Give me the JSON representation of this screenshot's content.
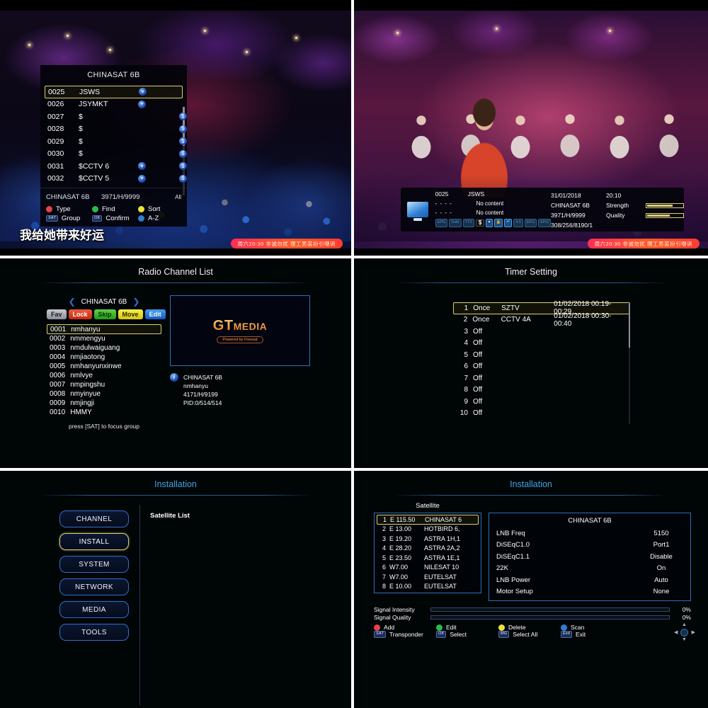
{
  "panel_channel_list": {
    "title": "CHINASAT 6B",
    "rows": [
      {
        "num": "0025",
        "name": "JSWS",
        "fav": true,
        "scrambled": false,
        "selected": true
      },
      {
        "num": "0026",
        "name": "JSYMKT",
        "fav": true,
        "scrambled": false,
        "selected": false
      },
      {
        "num": "0027",
        "name": "$",
        "fav": false,
        "scrambled": true,
        "selected": false
      },
      {
        "num": "0028",
        "name": "$",
        "fav": false,
        "scrambled": true,
        "selected": false
      },
      {
        "num": "0029",
        "name": "$",
        "fav": false,
        "scrambled": true,
        "selected": false
      },
      {
        "num": "0030",
        "name": "$",
        "fav": false,
        "scrambled": true,
        "selected": false
      },
      {
        "num": "0031",
        "name": "$CCTV 6",
        "fav": true,
        "scrambled": true,
        "selected": false
      },
      {
        "num": "0032",
        "name": "$CCTV 5",
        "fav": true,
        "scrambled": true,
        "selected": false
      }
    ],
    "footer": {
      "satellite": "CHINASAT 6B",
      "transponder": "3971/H/9999",
      "filter": "All"
    },
    "keys_row1": [
      {
        "color": "#e8414a",
        "label": "Type"
      },
      {
        "color": "#2fb84a",
        "label": "Find"
      },
      {
        "color": "#ece23a",
        "label": "Sort"
      }
    ],
    "keys_row2": [
      {
        "btn": "SAT",
        "label": "Group"
      },
      {
        "btn": "OK",
        "label": "Confirm"
      },
      {
        "color": "#2f7fd4",
        "label": "A-Z"
      }
    ],
    "subtitle": "我给她带来好运",
    "promo": "周六20:30 非诚勿扰 理工男装扮引嘲讽"
  },
  "panel_info_banner": {
    "channel_number": "0025",
    "channel_name": "JSWS",
    "events": [
      {
        "time": "- - - -",
        "name": "No content"
      },
      {
        "time": "- - - -",
        "name": "No content"
      }
    ],
    "icons": [
      "EPG",
      "Subt",
      "TTX",
      "$",
      "fav-heart",
      "lock",
      "repeat",
      "4:3",
      "EPG",
      "EPG"
    ],
    "date": "31/01/2018",
    "time": "20:10",
    "satellite": "CHINASAT 6B",
    "transponder": "3971/H/9999",
    "pids": "308/256/8190/1",
    "strength_label": "Strength",
    "quality_label": "Quality",
    "strength_pct": 78,
    "quality_pct": 72,
    "promo": "周六20:30 非诚勿扰 理工男装扮引嘲讽"
  },
  "panel_radio": {
    "title": "Radio Channel List",
    "group": "CHINASAT 6B",
    "tags": [
      {
        "label": "Fav",
        "cls": "fav"
      },
      {
        "label": "Lock",
        "cls": "lock"
      },
      {
        "label": "Skip",
        "cls": "skip"
      },
      {
        "label": "Move",
        "cls": "move"
      },
      {
        "label": "Edit",
        "cls": "edit"
      }
    ],
    "rows": [
      {
        "num": "0001",
        "name": "nmhanyu",
        "selected": true
      },
      {
        "num": "0002",
        "name": "nmmengyu",
        "selected": false
      },
      {
        "num": "0003",
        "name": "nmdulwaiguang",
        "selected": false
      },
      {
        "num": "0004",
        "name": "nmjiaotong",
        "selected": false
      },
      {
        "num": "0005",
        "name": "nmhanyunxinwe",
        "selected": false
      },
      {
        "num": "0006",
        "name": "nmlvye",
        "selected": false
      },
      {
        "num": "0007",
        "name": "nmpingshu",
        "selected": false
      },
      {
        "num": "0008",
        "name": "nmyinyue",
        "selected": false
      },
      {
        "num": "0009",
        "name": "nmjingji",
        "selected": false
      },
      {
        "num": "0010",
        "name": "HMMY",
        "selected": false
      }
    ],
    "hint": "press [SAT] to focus group",
    "logo_main": "GT",
    "logo_sub_main": "MEDIA",
    "logo_tagline": "Powered by Freesat",
    "info": [
      "CHINASAT 6B",
      "nmhanyu",
      "4171/H/9199",
      "PID:0/514/514"
    ]
  },
  "panel_timer": {
    "title": "Timer Setting",
    "rows": [
      {
        "index": "1",
        "mode": "Once",
        "channel": "SZTV",
        "schedule": "01/02/2018 00:19-00:29",
        "selected": true
      },
      {
        "index": "2",
        "mode": "Once",
        "channel": "CCTV 4A",
        "schedule": "01/02/2018 00:30-00:40",
        "selected": false
      },
      {
        "index": "3",
        "mode": "Off",
        "channel": "",
        "schedule": "",
        "selected": false
      },
      {
        "index": "4",
        "mode": "Off",
        "channel": "",
        "schedule": "",
        "selected": false
      },
      {
        "index": "5",
        "mode": "Off",
        "channel": "",
        "schedule": "",
        "selected": false
      },
      {
        "index": "6",
        "mode": "Off",
        "channel": "",
        "schedule": "",
        "selected": false
      },
      {
        "index": "7",
        "mode": "Off",
        "channel": "",
        "schedule": "",
        "selected": false
      },
      {
        "index": "8",
        "mode": "Off",
        "channel": "",
        "schedule": "",
        "selected": false
      },
      {
        "index": "9",
        "mode": "Off",
        "channel": "",
        "schedule": "",
        "selected": false
      },
      {
        "index": "10",
        "mode": "Off",
        "channel": "",
        "schedule": "",
        "selected": false
      }
    ]
  },
  "panel_install_menu": {
    "title": "Installation",
    "buttons": [
      {
        "label": "CHANNEL",
        "selected": false
      },
      {
        "label": "INSTALL",
        "selected": true
      },
      {
        "label": "SYSTEM",
        "selected": false
      },
      {
        "label": "NETWORK",
        "selected": false
      },
      {
        "label": "MEDIA",
        "selected": false
      },
      {
        "label": "TOOLS",
        "selected": false
      }
    ],
    "content_label": "Satellite List"
  },
  "panel_install_sat": {
    "title": "Installation",
    "sat_caption": "Satellite",
    "satellites": [
      {
        "n": "1",
        "pos": "E 115.50",
        "name": "CHINASAT 6",
        "selected": true
      },
      {
        "n": "2",
        "pos": "E 13.00",
        "name": "HOTBIRD 6,",
        "selected": false
      },
      {
        "n": "3",
        "pos": "E 19.20",
        "name": "ASTRA 1H,1",
        "selected": false
      },
      {
        "n": "4",
        "pos": "E 28.20",
        "name": "ASTRA 2A,2",
        "selected": false
      },
      {
        "n": "5",
        "pos": "E 23.50",
        "name": "ASTRA 1E,1",
        "selected": false
      },
      {
        "n": "6",
        "pos": "W7.00",
        "name": "NILESAT 10",
        "selected": false
      },
      {
        "n": "7",
        "pos": "W7.00",
        "name": "EUTELSAT",
        "selected": false
      },
      {
        "n": "8",
        "pos": "E 10.00",
        "name": "EUTELSAT",
        "selected": false
      }
    ],
    "lnb_title": "CHINASAT 6B",
    "lnb_rows": [
      {
        "key": "LNB Freq",
        "value": "5150"
      },
      {
        "key": "DiSEqC1.0",
        "value": "Port1"
      },
      {
        "key": "DiSEqC1.1",
        "value": "Disable"
      },
      {
        "key": "22K",
        "value": "On"
      },
      {
        "key": "LNB Power",
        "value": "Auto"
      },
      {
        "key": "Motor Setup",
        "value": "None"
      }
    ],
    "signal": [
      {
        "label": "Signal Intensity",
        "pct": "0%",
        "value": 0
      },
      {
        "label": "Signal Quality",
        "pct": "0%",
        "value": 0
      }
    ],
    "keys_row1": [
      {
        "color": "#e8414a",
        "label": "Add"
      },
      {
        "color": "#2fb84a",
        "label": "Edit"
      },
      {
        "color": "#ece23a",
        "label": "Delete"
      },
      {
        "color": "#2f7fd4",
        "label": "Scan"
      }
    ],
    "keys_row2": [
      {
        "btn": "SAT",
        "label": "Transponder"
      },
      {
        "btn": "OK",
        "label": "Select"
      },
      {
        "btn": "MG",
        "label": "Select All"
      },
      {
        "btn": "Exit",
        "label": "Exit"
      }
    ]
  }
}
